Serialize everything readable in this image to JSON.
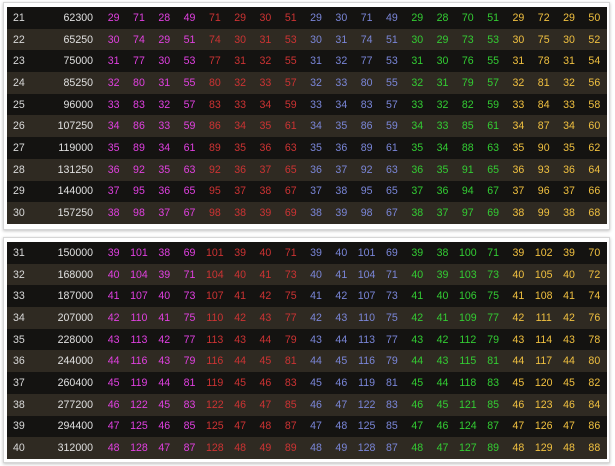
{
  "colors": {
    "magenta": "#e040e0",
    "red": "#cc3333",
    "blue": "#7a86d8",
    "green": "#33cc33",
    "yellow": "#f0c040",
    "row_dark": "#141311",
    "row_brown": "#2f2a22"
  },
  "tables": [
    {
      "rows": [
        {
          "level": "21",
          "exp": "62300",
          "stats": [
            "29",
            "71",
            "28",
            "49",
            "71",
            "29",
            "30",
            "51",
            "29",
            "30",
            "71",
            "49",
            "29",
            "28",
            "70",
            "51",
            "29",
            "72",
            "29",
            "50"
          ]
        },
        {
          "level": "22",
          "exp": "65250",
          "stats": [
            "30",
            "74",
            "29",
            "51",
            "74",
            "30",
            "31",
            "53",
            "30",
            "31",
            "74",
            "51",
            "30",
            "29",
            "73",
            "53",
            "30",
            "75",
            "30",
            "52"
          ]
        },
        {
          "level": "23",
          "exp": "75000",
          "stats": [
            "31",
            "77",
            "30",
            "53",
            "77",
            "31",
            "32",
            "55",
            "31",
            "32",
            "77",
            "53",
            "31",
            "30",
            "76",
            "55",
            "31",
            "78",
            "31",
            "54"
          ]
        },
        {
          "level": "24",
          "exp": "85250",
          "stats": [
            "32",
            "80",
            "31",
            "55",
            "80",
            "32",
            "33",
            "57",
            "32",
            "33",
            "80",
            "55",
            "32",
            "31",
            "79",
            "57",
            "32",
            "81",
            "32",
            "56"
          ]
        },
        {
          "level": "25",
          "exp": "96000",
          "stats": [
            "33",
            "83",
            "32",
            "57",
            "83",
            "33",
            "34",
            "59",
            "33",
            "34",
            "83",
            "57",
            "33",
            "32",
            "82",
            "59",
            "33",
            "84",
            "33",
            "58"
          ]
        },
        {
          "level": "26",
          "exp": "107250",
          "stats": [
            "34",
            "86",
            "33",
            "59",
            "86",
            "34",
            "35",
            "61",
            "34",
            "35",
            "86",
            "59",
            "34",
            "33",
            "85",
            "61",
            "34",
            "87",
            "34",
            "60"
          ]
        },
        {
          "level": "27",
          "exp": "119000",
          "stats": [
            "35",
            "89",
            "34",
            "61",
            "89",
            "35",
            "36",
            "63",
            "35",
            "36",
            "89",
            "61",
            "35",
            "34",
            "88",
            "63",
            "35",
            "90",
            "35",
            "62"
          ]
        },
        {
          "level": "28",
          "exp": "131250",
          "stats": [
            "36",
            "92",
            "35",
            "63",
            "92",
            "36",
            "37",
            "65",
            "36",
            "37",
            "92",
            "63",
            "36",
            "35",
            "91",
            "65",
            "36",
            "93",
            "36",
            "64"
          ]
        },
        {
          "level": "29",
          "exp": "144000",
          "stats": [
            "37",
            "95",
            "36",
            "65",
            "95",
            "37",
            "38",
            "67",
            "37",
            "38",
            "95",
            "65",
            "37",
            "36",
            "94",
            "67",
            "37",
            "96",
            "37",
            "66"
          ]
        },
        {
          "level": "30",
          "exp": "157250",
          "stats": [
            "38",
            "98",
            "37",
            "67",
            "98",
            "38",
            "39",
            "69",
            "38",
            "39",
            "98",
            "67",
            "38",
            "37",
            "97",
            "69",
            "38",
            "99",
            "38",
            "68"
          ]
        }
      ]
    },
    {
      "rows": [
        {
          "level": "31",
          "exp": "150000",
          "stats": [
            "39",
            "101",
            "38",
            "69",
            "101",
            "39",
            "40",
            "71",
            "39",
            "40",
            "101",
            "69",
            "39",
            "38",
            "100",
            "71",
            "39",
            "102",
            "39",
            "70"
          ]
        },
        {
          "level": "32",
          "exp": "168000",
          "stats": [
            "40",
            "104",
            "39",
            "71",
            "104",
            "40",
            "41",
            "73",
            "40",
            "41",
            "104",
            "71",
            "40",
            "39",
            "103",
            "73",
            "40",
            "105",
            "40",
            "72"
          ]
        },
        {
          "level": "33",
          "exp": "187000",
          "stats": [
            "41",
            "107",
            "40",
            "73",
            "107",
            "41",
            "42",
            "75",
            "41",
            "42",
            "107",
            "73",
            "41",
            "40",
            "106",
            "75",
            "41",
            "108",
            "41",
            "74"
          ]
        },
        {
          "level": "34",
          "exp": "207000",
          "stats": [
            "42",
            "110",
            "41",
            "75",
            "110",
            "42",
            "43",
            "77",
            "42",
            "43",
            "110",
            "75",
            "42",
            "41",
            "109",
            "77",
            "42",
            "111",
            "42",
            "76"
          ]
        },
        {
          "level": "35",
          "exp": "228000",
          "stats": [
            "43",
            "113",
            "42",
            "77",
            "113",
            "43",
            "44",
            "79",
            "43",
            "44",
            "113",
            "77",
            "43",
            "42",
            "112",
            "79",
            "43",
            "114",
            "43",
            "78"
          ]
        },
        {
          "level": "36",
          "exp": "244000",
          "stats": [
            "44",
            "116",
            "43",
            "79",
            "116",
            "44",
            "45",
            "81",
            "44",
            "45",
            "116",
            "79",
            "44",
            "43",
            "115",
            "81",
            "44",
            "117",
            "44",
            "80"
          ]
        },
        {
          "level": "37",
          "exp": "260400",
          "stats": [
            "45",
            "119",
            "44",
            "81",
            "119",
            "45",
            "46",
            "83",
            "45",
            "46",
            "119",
            "81",
            "45",
            "44",
            "118",
            "83",
            "45",
            "120",
            "45",
            "82"
          ]
        },
        {
          "level": "38",
          "exp": "277200",
          "stats": [
            "46",
            "122",
            "45",
            "83",
            "122",
            "46",
            "47",
            "85",
            "46",
            "47",
            "122",
            "83",
            "46",
            "45",
            "121",
            "85",
            "46",
            "123",
            "46",
            "84"
          ]
        },
        {
          "level": "39",
          "exp": "294400",
          "stats": [
            "47",
            "125",
            "46",
            "85",
            "125",
            "47",
            "48",
            "87",
            "47",
            "48",
            "125",
            "85",
            "47",
            "46",
            "124",
            "87",
            "47",
            "126",
            "47",
            "86"
          ]
        },
        {
          "level": "40",
          "exp": "312000",
          "stats": [
            "48",
            "128",
            "47",
            "87",
            "128",
            "48",
            "49",
            "89",
            "48",
            "49",
            "128",
            "87",
            "48",
            "47",
            "127",
            "89",
            "48",
            "129",
            "48",
            "88"
          ]
        }
      ]
    }
  ]
}
